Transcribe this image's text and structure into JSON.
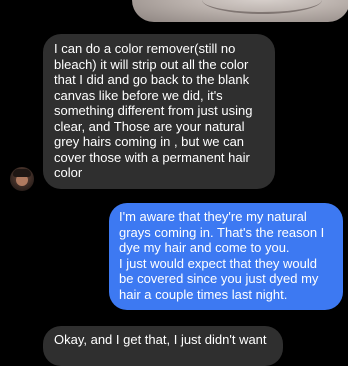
{
  "conversation": {
    "messages": [
      {
        "direction": "incoming",
        "text": "I can do a color remover(still no bleach) it will strip out all the color that I did and go back to the blank canvas like before we did, it's something different from just using clear, and Those are your natural grey hairs coming in , but we can cover those with a permanent hair color"
      },
      {
        "direction": "outgoing",
        "text": "I'm aware that they're my natural grays coming in. That's the reason I dye my hair and come to you.\nI just would expect that they would be covered since you just dyed my hair a couple times last night."
      },
      {
        "direction": "incoming",
        "text": "Okay, and I get that, I just didn't want"
      }
    ]
  },
  "colors": {
    "background": "#000000",
    "incoming_bubble": "#2f2f2f",
    "outgoing_bubble": "#3d79f2",
    "text": "#ffffff"
  }
}
